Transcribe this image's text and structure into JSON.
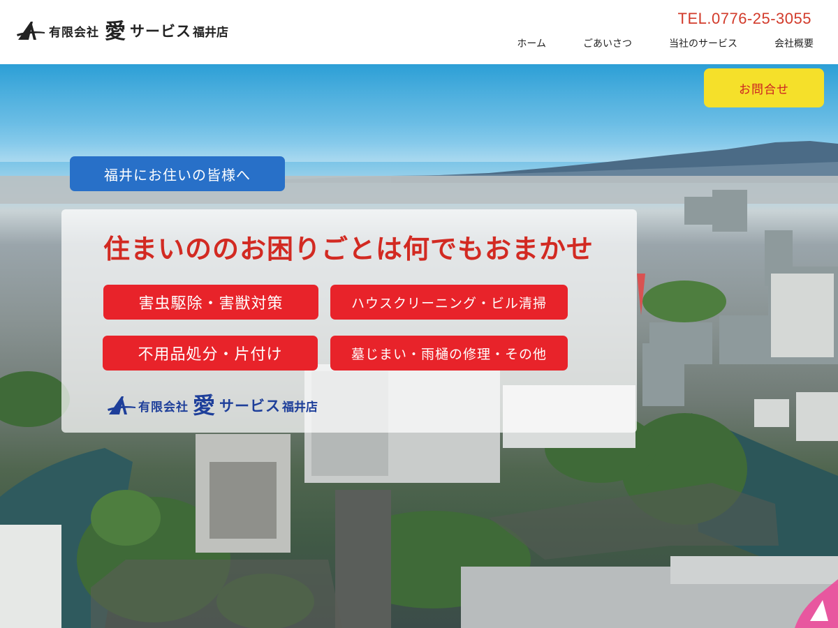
{
  "header": {
    "logo": {
      "company_type": "有限会社",
      "ai_char": "愛",
      "service": "サービス",
      "shop": "福井店"
    },
    "tel": "TEL.0776-25-3055",
    "nav": [
      {
        "label": "ホーム"
      },
      {
        "label": "ごあいさつ"
      },
      {
        "label": "当社のサービス"
      },
      {
        "label": "会社概要"
      }
    ]
  },
  "hero": {
    "contact_button": "お問合せ",
    "tag": "福井にお住いの皆様へ",
    "headline": "住まいののお困りごとは何でもおまかせ",
    "services": [
      {
        "label": "害虫駆除・害獣対策"
      },
      {
        "label": "ハウスクリーニング・ビル清掃"
      },
      {
        "label": "不用品処分・片付け"
      },
      {
        "label": "墓じまい・雨樋の修理・その他"
      }
    ],
    "panel_logo": {
      "company_type": "有限会社",
      "ai_char": "愛",
      "service": "サービス",
      "shop": "福井店"
    }
  },
  "colors": {
    "accent_red": "#e8232a",
    "headline_red": "#d22a22",
    "tag_blue": "#2870c8",
    "contact_yellow": "#f5e02a",
    "logo_navy": "#1e3f9a",
    "corner_pink": "#f0459a"
  },
  "icons": [
    "logo-a-mark",
    "corner-arrow-icon"
  ]
}
